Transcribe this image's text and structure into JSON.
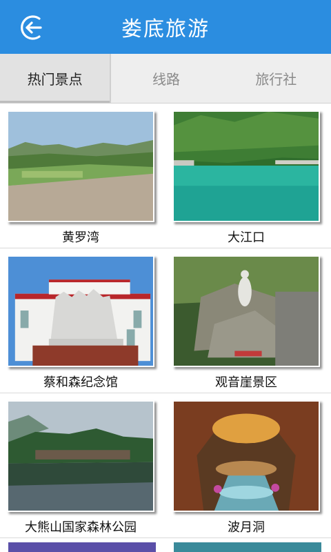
{
  "header": {
    "title": "娄底旅游"
  },
  "tabs": [
    {
      "label": "热门景点",
      "active": true
    },
    {
      "label": "线路",
      "active": false
    },
    {
      "label": "旅行社",
      "active": false
    }
  ],
  "spots": [
    {
      "name": "黄罗湾"
    },
    {
      "name": "大江口"
    },
    {
      "name": "蔡和森纪念馆"
    },
    {
      "name": "观音崖景区"
    },
    {
      "name": "大熊山国家森林公园"
    },
    {
      "name": "波月洞"
    }
  ],
  "colors": {
    "header": "#2b8de0",
    "tab_bg": "#eeeeee",
    "tab_active_bg": "#e2e2e2"
  },
  "icons": {
    "back": "back-arrow-circle-icon"
  }
}
